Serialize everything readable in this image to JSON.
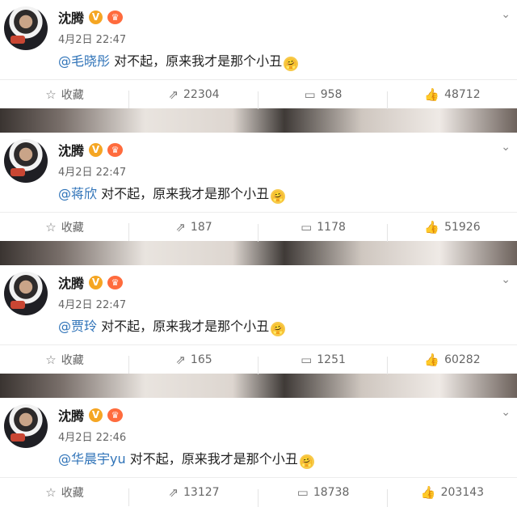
{
  "posts": [
    {
      "name": "沈腾",
      "time": "4月2日 22:47",
      "mention": "@毛晓彤",
      "text": " 对不起，原来我才是那个小丑",
      "actions": {
        "fav": "收藏",
        "repost": "22304",
        "comment": "958",
        "like": "48712"
      }
    },
    {
      "name": "沈腾",
      "time": "4月2日 22:47",
      "mention": "@蒋欣",
      "text": " 对不起，原来我才是那个小丑",
      "actions": {
        "fav": "收藏",
        "repost": "187",
        "comment": "1178",
        "like": "51926"
      }
    },
    {
      "name": "沈腾",
      "time": "4月2日 22:47",
      "mention": "@贾玲",
      "text": " 对不起，原来我才是那个小丑",
      "actions": {
        "fav": "收藏",
        "repost": "165",
        "comment": "1251",
        "like": "60282"
      }
    },
    {
      "name": "沈腾",
      "time": "4月2日 22:46",
      "mention": "@华晨宇yu",
      "text": " 对不起，原来我才是那个小丑",
      "actions": {
        "fav": "收藏",
        "repost": "13127",
        "comment": "18738",
        "like": "203143"
      }
    }
  ],
  "icons": {
    "verified": "V",
    "crown": "♛",
    "star": "☆",
    "repost": "⇗",
    "comment": "▭",
    "like": "👍",
    "chevron": "⌄",
    "emoji": "🤗"
  }
}
